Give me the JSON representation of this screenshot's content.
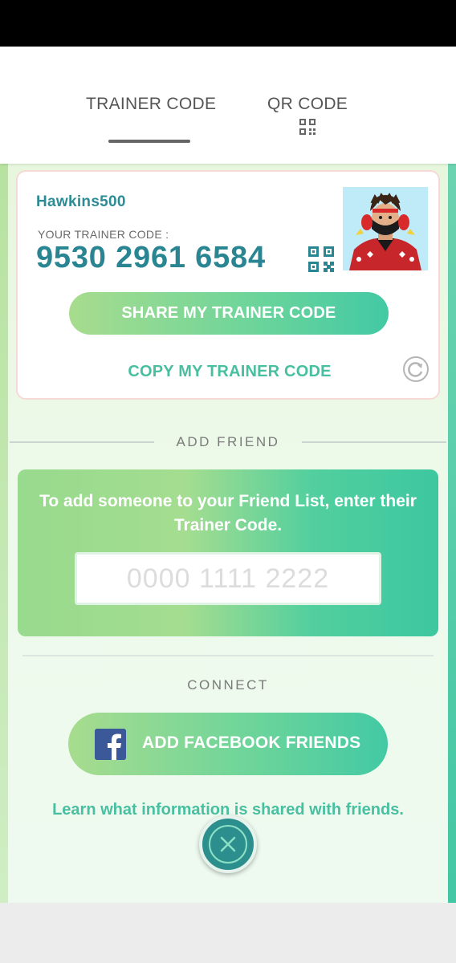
{
  "tabs": {
    "trainer_code": "TRAINER CODE",
    "qr_code": "QR CODE"
  },
  "profile": {
    "username": "Hawkins500",
    "code_label": "YOUR TRAINER CODE :",
    "trainer_code": "9530 2961 6584"
  },
  "actions": {
    "share_label": "SHARE MY TRAINER CODE",
    "copy_label": "COPY MY TRAINER CODE"
  },
  "add_friend": {
    "header": "ADD FRIEND",
    "instructions": "To add someone to your Friend List, enter their Trainer Code.",
    "input_placeholder": "0000 1111 2222"
  },
  "connect": {
    "header": "CONNECT",
    "facebook_label": "ADD FACEBOOK FRIENDS",
    "learn_link": "Learn what information is shared with friends."
  },
  "icons": {
    "qr": "qr-code-icon",
    "refresh": "refresh-icon",
    "facebook": "facebook-icon",
    "close": "close-icon"
  },
  "colors": {
    "accent_teal": "#2a8593",
    "link_green": "#48bfa0",
    "facebook_blue": "#3b5998"
  }
}
